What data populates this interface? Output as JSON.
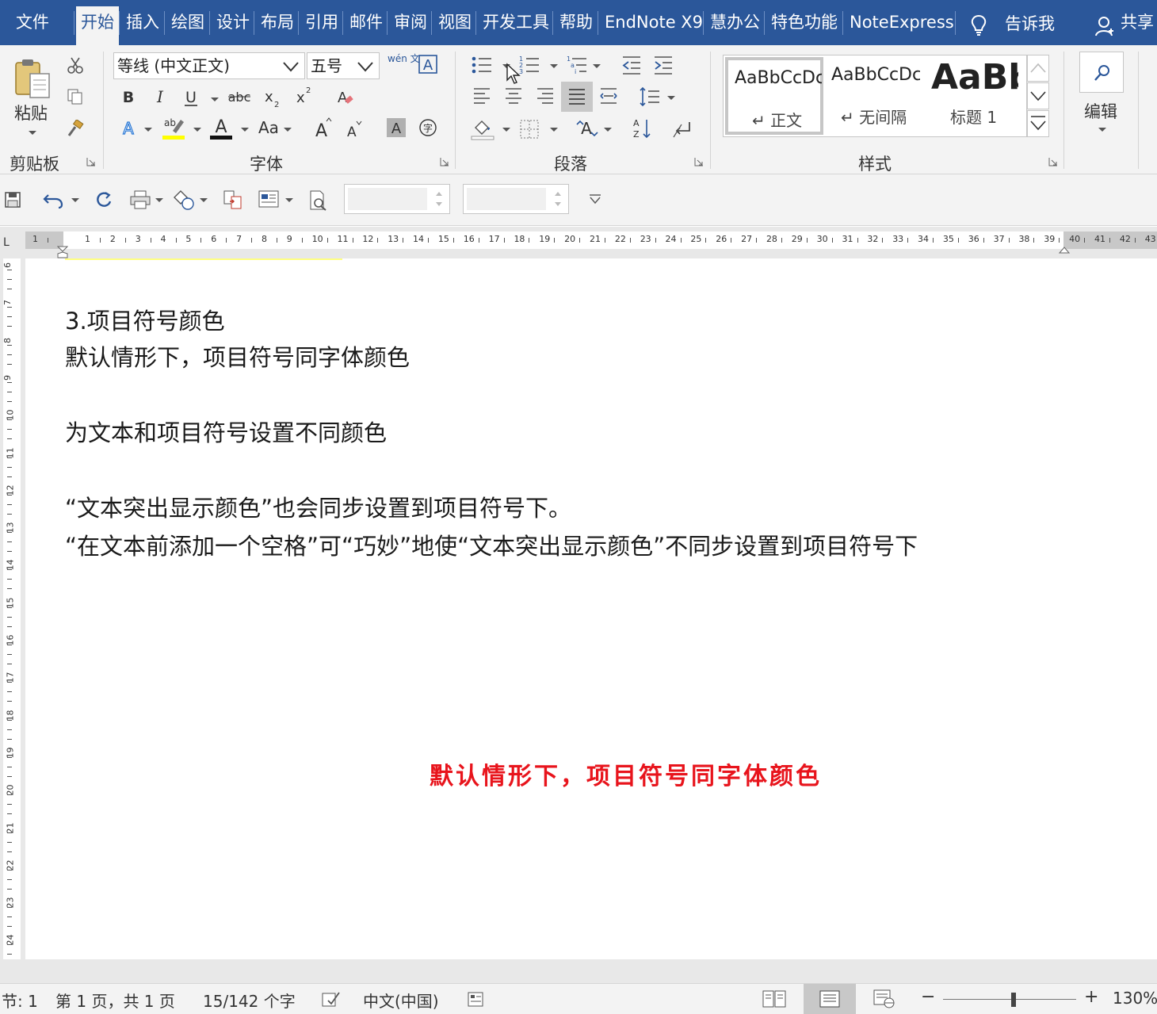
{
  "tabs": [
    {
      "label": "文件",
      "active": false
    },
    {
      "label": "开始",
      "active": true
    },
    {
      "label": "插入",
      "active": false
    },
    {
      "label": "绘图",
      "active": false
    },
    {
      "label": "设计",
      "active": false
    },
    {
      "label": "布局",
      "active": false
    },
    {
      "label": "引用",
      "active": false
    },
    {
      "label": "邮件",
      "active": false
    },
    {
      "label": "审阅",
      "active": false
    },
    {
      "label": "视图",
      "active": false
    },
    {
      "label": "开发工具",
      "active": false
    },
    {
      "label": "帮助",
      "active": false
    },
    {
      "label": "EndNote X9",
      "active": false
    },
    {
      "label": "慧办公",
      "active": false
    },
    {
      "label": "特色功能",
      "active": false
    },
    {
      "label": "NoteExpress",
      "active": false
    }
  ],
  "tell_me": "告诉我",
  "share": "共享",
  "ribbon": {
    "clipboard": {
      "label": "剪贴板",
      "paste": "粘贴"
    },
    "font": {
      "label": "字体",
      "font_name": "等线 (中文正文)",
      "font_size": "五号",
      "phonetic": "wén 文",
      "change_case": "Aa"
    },
    "paragraph": {
      "label": "段落"
    },
    "styles": {
      "label": "样式",
      "items": [
        {
          "sample": "AaBbCcDc",
          "name": "↵ 正文",
          "selected": true
        },
        {
          "sample": "AaBbCcDc",
          "name": "↵ 无间隔",
          "selected": false
        },
        {
          "sample": "AaBb",
          "name": "标题 1",
          "selected": false
        }
      ]
    },
    "editing": {
      "label": "编辑"
    }
  },
  "ruler": {
    "numbers": [
      "1",
      "1",
      "2",
      "3",
      "4",
      "5",
      "6",
      "7",
      "8",
      "9",
      "10",
      "11",
      "12",
      "13",
      "14",
      "15",
      "16",
      "17",
      "18",
      "19",
      "20",
      "21",
      "22",
      "23",
      "24",
      "25",
      "26",
      "27",
      "28",
      "29",
      "30",
      "31",
      "32",
      "33",
      "34",
      "35",
      "36",
      "37",
      "38",
      "39",
      "40",
      "41",
      "42",
      "43"
    ],
    "vertical_numbers": [
      "6",
      "7",
      "8",
      "9",
      "10",
      "11",
      "12",
      "13",
      "14",
      "15",
      "16",
      "17",
      "18",
      "19",
      "20",
      "21",
      "22",
      "23",
      "24"
    ]
  },
  "document": {
    "lines": [
      "3.项目符号颜色",
      "默认情形下，项目符号同字体颜色",
      "",
      "为文本和项目符号设置不同颜色",
      "",
      "“文本突出显示颜色”也会同步设置到项目符号下。",
      "“在文本前添加一个空格”可“巧妙”地使“文本突出显示颜色”不同步设置到项目符号下"
    ],
    "caption": "默认情形下，项目符号同字体颜色",
    "caption_color": "#e8141c"
  },
  "status": {
    "section": "节: 1",
    "page": "第 1 页，共 1 页",
    "words": "15/142 个字",
    "language": "中文(中国)",
    "zoom": "130%",
    "zoom_minus": "−",
    "zoom_plus": "+"
  },
  "colors": {
    "brand": "#2b579a",
    "ribbon_bg": "#f3f3f3"
  }
}
